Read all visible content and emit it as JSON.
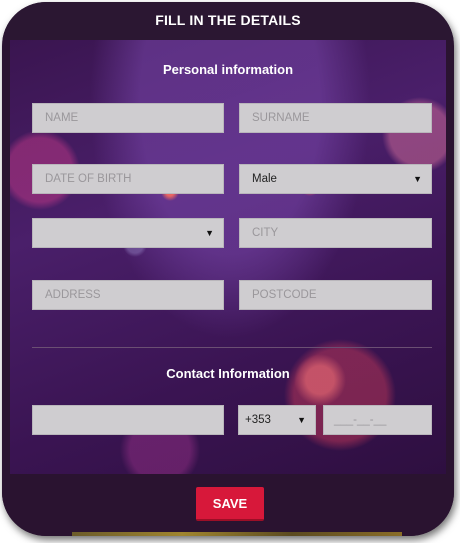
{
  "header": {
    "title": "FILL IN THE DETAILS"
  },
  "personal": {
    "heading": "Personal information",
    "name_placeholder": "NAME",
    "surname_placeholder": "SURNAME",
    "dob_placeholder": "DATE OF BIRTH",
    "gender_value": "Male",
    "country_value": "",
    "city_placeholder": "CITY",
    "address_placeholder": "ADDRESS",
    "postcode_placeholder": "POSTCODE"
  },
  "contact": {
    "heading": "Contact Information",
    "email_value": "",
    "phone_code_value": "+353",
    "phone_placeholder": "___-__-__"
  },
  "actions": {
    "save_label": "SAVE"
  },
  "icons": {
    "dropdown": "chevron-down-icon"
  },
  "colors": {
    "accent": "#d7183a",
    "field_bg": "#cfcdd0",
    "frame": "#2a1330"
  }
}
